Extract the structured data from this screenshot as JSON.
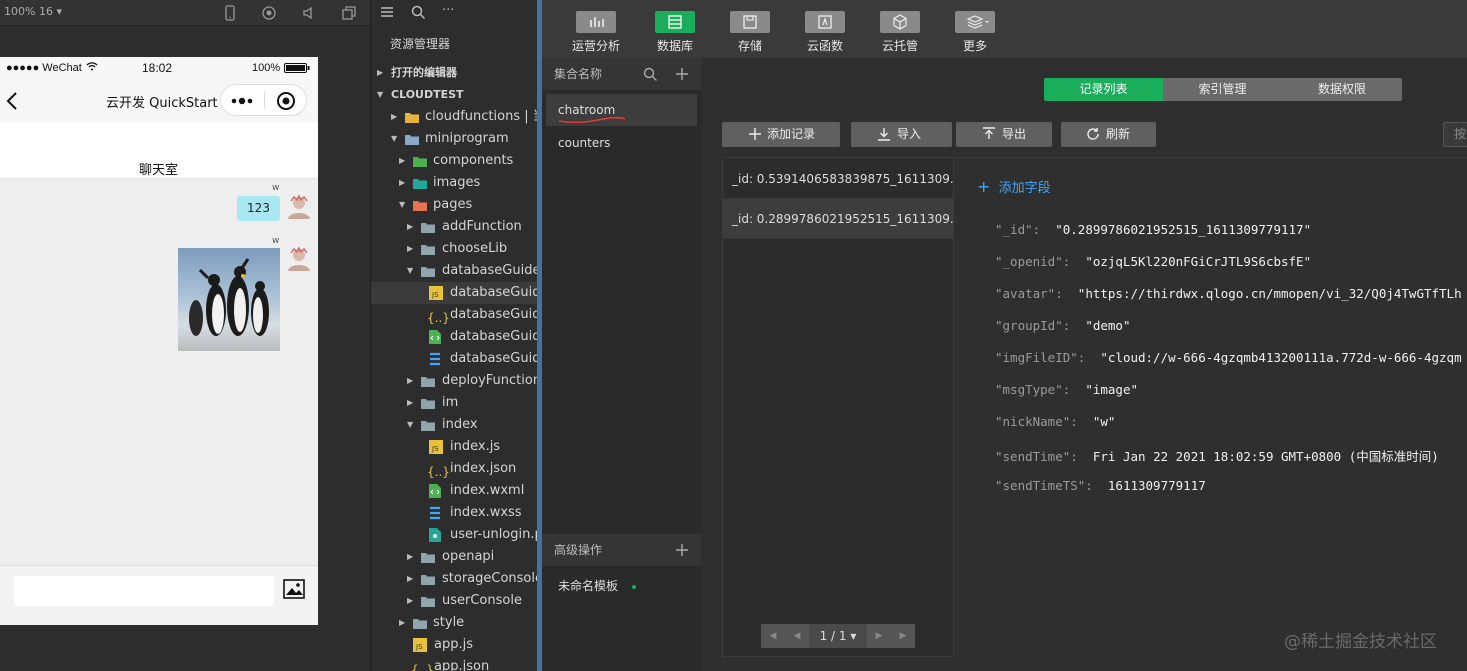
{
  "simulator": {
    "zoom": "100% 16 ▾",
    "status": {
      "carrier": "●●●●● WeChat",
      "time": "18:02",
      "battery": "100%"
    },
    "nav_title": "云开发 QuickStart",
    "room_title": "聊天室",
    "messages": [
      {
        "sender": "w",
        "type": "text",
        "text": "123"
      },
      {
        "sender": "w",
        "type": "image"
      }
    ]
  },
  "explorer": {
    "title": "资源管理器",
    "sections": {
      "open_editors": "打开的编辑器",
      "project": "CLOUDTEST"
    },
    "items": [
      {
        "label": "cloudfunctions | 当"
      },
      {
        "label": "miniprogram"
      },
      {
        "label": "components"
      },
      {
        "label": "images"
      },
      {
        "label": "pages"
      },
      {
        "label": "addFunction"
      },
      {
        "label": "chooseLib"
      },
      {
        "label": "databaseGuide"
      },
      {
        "label": "databaseGuide"
      },
      {
        "label": "databaseGuide"
      },
      {
        "label": "databaseGuide"
      },
      {
        "label": "databaseGuide"
      },
      {
        "label": "deployFunctions"
      },
      {
        "label": "im"
      },
      {
        "label": "index"
      },
      {
        "label": "index.js"
      },
      {
        "label": "index.json"
      },
      {
        "label": "index.wxml"
      },
      {
        "label": "index.wxss"
      },
      {
        "label": "user-unlogin.p"
      },
      {
        "label": "openapi"
      },
      {
        "label": "storageConsole"
      },
      {
        "label": "userConsole"
      },
      {
        "label": "style"
      },
      {
        "label": "app.js"
      },
      {
        "label": "app.json"
      }
    ]
  },
  "toolbar": {
    "items": [
      {
        "label": "运营分析",
        "icon": "chart-icon"
      },
      {
        "label": "数据库",
        "icon": "database-icon"
      },
      {
        "label": "存储",
        "icon": "storage-icon"
      },
      {
        "label": "云函数",
        "icon": "function-icon"
      },
      {
        "label": "云托管",
        "icon": "cube-icon"
      },
      {
        "label": "更多",
        "icon": "layers-icon"
      }
    ]
  },
  "collections": {
    "header": "集合名称",
    "items": [
      "chatroom",
      "counters"
    ],
    "advanced_header": "高级操作",
    "templates": [
      "未命名模板"
    ]
  },
  "tabs": [
    "记录列表",
    "索引管理",
    "数据权限"
  ],
  "actions": {
    "add": "添加记录",
    "import": "导入",
    "export": "导出",
    "refresh": "刷新",
    "search_partial": "按"
  },
  "records": [
    "_id: 0.5391406583839875_1611309...",
    "_id: 0.2899786021952515_1611309..."
  ],
  "pager": "1 / 1",
  "detail": {
    "add_field": "添加字段",
    "fields": [
      {
        "key": "\"_id\":",
        "value": "\"0.2899786021952515_1611309779117\""
      },
      {
        "key": "\"_openid\":",
        "value": "\"ozjqL5Kl220nFGiCrJTL9S6cbsfE\""
      },
      {
        "key": "\"avatar\":",
        "value": "\"https://thirdwx.qlogo.cn/mmopen/vi_32/Q0j4TwGTfTLh"
      },
      {
        "key": "\"groupId\":",
        "value": "\"demo\""
      },
      {
        "key": "\"imgFileID\":",
        "value": "\"cloud://w-666-4gzqmb413200111a.772d-w-666-4gzqm"
      },
      {
        "key": "\"msgType\":",
        "value": "\"image\""
      },
      {
        "key": "\"nickName\":",
        "value": "\"w\""
      },
      {
        "key": "\"sendTime\":",
        "value": "Fri Jan 22 2021 18:02:59 GMT+0800 (中国标准时间)"
      },
      {
        "key": "\"sendTimeTS\":",
        "value": "1611309779117"
      }
    ]
  },
  "watermark": "@稀土掘金技术社区",
  "colors": {
    "accent": "#1aad5a",
    "bubble": "#a9e8f0",
    "underline": "#e53935"
  }
}
